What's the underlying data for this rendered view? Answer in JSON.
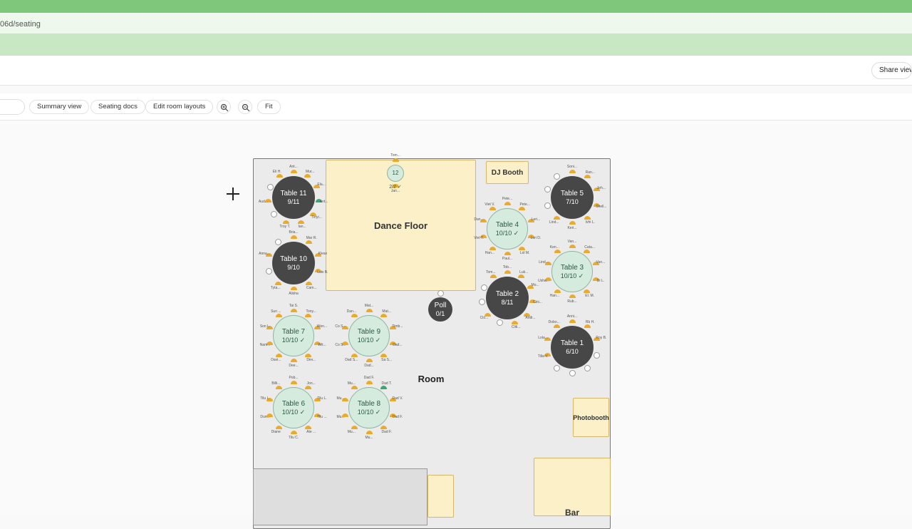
{
  "browser": {
    "url": "06d/seating"
  },
  "header": {
    "share_label": "Share view"
  },
  "toolbar": {
    "summary_label": "Summary view",
    "docs_label": "Seating docs",
    "edit_label": "Edit room layouts",
    "fit_label": "Fit",
    "zoom_in_icon": "zoom-in-icon",
    "zoom_out_icon": "zoom-out-icon"
  },
  "room": {
    "name": "Room",
    "zones": {
      "dance_floor": "Dance Floor",
      "dj_booth": "DJ Booth",
      "photobooth": "Photobooth",
      "bar": "Bar"
    },
    "colors": {
      "occupied_seat": "#e9ab2c",
      "full_table": "#d4ebde",
      "open_table": "#474747"
    }
  },
  "tables": [
    {
      "id": "t11",
      "name": "Table 11",
      "count": "9/11",
      "full": false
    },
    {
      "id": "t10",
      "name": "Table 10",
      "count": "9/10",
      "full": false
    },
    {
      "id": "t7",
      "name": "Table 7",
      "count": "10/10 ✓",
      "full": true
    },
    {
      "id": "t6",
      "name": "Table 6",
      "count": "10/10 ✓",
      "full": true
    },
    {
      "id": "t9",
      "name": "Table 9",
      "count": "10/10 ✓",
      "full": true
    },
    {
      "id": "t8",
      "name": "Table 8",
      "count": "10/10 ✓",
      "full": true
    },
    {
      "id": "t12",
      "name": "12",
      "count": "2/2 ✓",
      "full": true
    },
    {
      "id": "poll",
      "name": "Poll",
      "count": "0/1",
      "full": false
    },
    {
      "id": "t4",
      "name": "Table 4",
      "count": "10/10 ✓",
      "full": true
    },
    {
      "id": "t2",
      "name": "Table 2",
      "count": "8/11",
      "full": false
    },
    {
      "id": "t5",
      "name": "Table 5",
      "count": "7/10",
      "full": false
    },
    {
      "id": "t3",
      "name": "Table 3",
      "count": "10/10 ✓",
      "full": true
    },
    {
      "id": "t1",
      "name": "Table 1",
      "count": "6/10",
      "full": false
    }
  ],
  "guests": {
    "t11": [
      "Ant...",
      "Mur...",
      "Ela...",
      "Ant...",
      "Tinyi...",
      "Ian...",
      "Troy T.",
      "Aud...",
      "Eli H."
    ],
    "t10": [
      "Bria...",
      "Mar R.",
      "Kleav",
      "Luis B.",
      "Cam...",
      "Alisha",
      "Tyta...",
      "Anna..."
    ],
    "t7": [
      "Tai S.",
      "Tony...",
      "Wen...",
      "Wit...",
      "Dev...",
      "Dee...",
      "Davi...",
      "Nam...",
      "Son L.",
      "Sun ..."
    ],
    "t6": [
      "Pob...",
      "Jon...",
      "Tilu L.",
      "Tilu ...",
      "Ate ...",
      "Tilu C.",
      "Diane",
      "Dun...",
      "Tilu L.",
      "Billi..."
    ],
    "t9": [
      "Mat...",
      "Mat...",
      "Timb...",
      "Dad...",
      "Sa S...",
      "Dad...",
      "Dad S...",
      "Co S...",
      "Co S...",
      "Dan..."
    ],
    "t8": [
      "Dad F.",
      "Dad T.",
      "Dad V.",
      "Dad F.",
      "Dad F.",
      "Mu...",
      "Mu...",
      "Mu...",
      "Mu...",
      "Mu..."
    ],
    "t12": [
      "Tom...",
      "Jan..."
    ],
    "t4": [
      "Pete...",
      "Pete...",
      "Leri...",
      "Lori D.",
      "Lol M.",
      "Paul...",
      "Han...",
      "Viet T.",
      "Dan...",
      "Viet V."
    ],
    "t2": [
      "Tob...",
      "Luk...",
      "Mo...",
      "Cini...",
      "Andi...",
      "Cliti...",
      "Clo...",
      "Tom..."
    ],
    "t5": [
      "Soni...",
      "Ran...",
      "Jeh...",
      "Shell...",
      "Ivhi L.",
      "Keri...",
      "Lind..."
    ],
    "t3": [
      "Van...",
      "Cata...",
      "Van...",
      "Di L.",
      "El. M.",
      "Rub...",
      "Han...",
      "Usha...",
      "Lind...",
      "Ken..."
    ],
    "t1": [
      "Anni...",
      "Rb H.",
      "Roy B.",
      "Tilia V.",
      "Lola...",
      "Dobo..."
    ]
  }
}
